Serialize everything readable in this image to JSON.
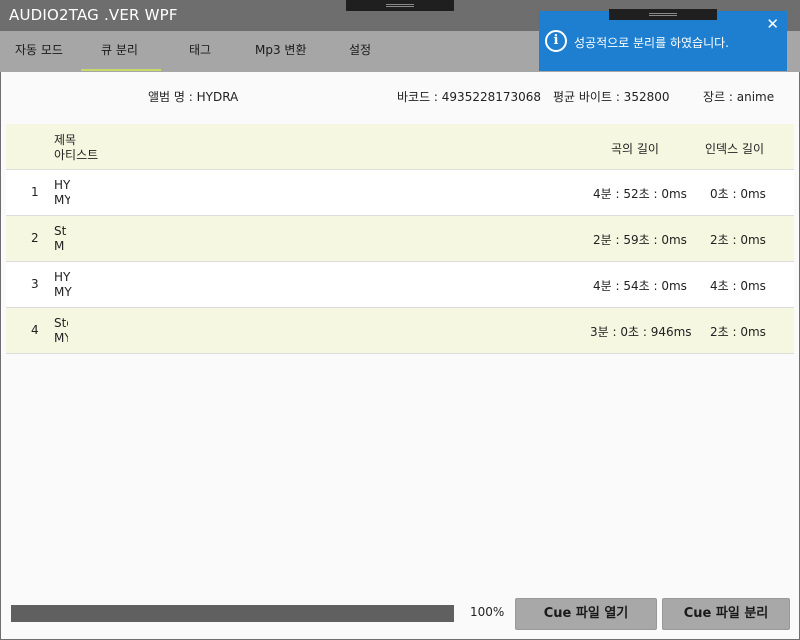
{
  "window": {
    "title": "AUDIO2TAG .VER WPF"
  },
  "tabs": [
    "자동 모드",
    "큐 분리",
    "태그",
    "Mp3 변환",
    "설정"
  ],
  "album": {
    "name_label": "앨범 명 : HYDRA",
    "barcode_label": "바코드 : 4935228173068",
    "bitrate_label": "평균 바이트 : 352800",
    "genre_label": "장르 : anime"
  },
  "table": {
    "headers": {
      "title": "제목",
      "artist": "아티스트",
      "length": "곡의 길이",
      "index_length": "인덱스 길이"
    },
    "rows": [
      {
        "no": "1",
        "title": "HY",
        "artist": "MY",
        "length": "4분 : 52초 : 0ms",
        "index": "0초 : 0ms"
      },
      {
        "no": "2",
        "title": "St",
        "artist": "M",
        "length": "2분 : 59초 : 0ms",
        "index": "2초 : 0ms"
      },
      {
        "no": "3",
        "title": "HY",
        "artist": "MY",
        "length": "4분 : 54초 : 0ms",
        "index": "4초 : 0ms"
      },
      {
        "no": "4",
        "title": "Sto",
        "artist": "MY",
        "length": "3분 : 0초 : 946ms",
        "index": "2초 : 0ms"
      }
    ]
  },
  "progress": {
    "value": 1.0,
    "label": "100%"
  },
  "buttons": {
    "open_cue": "Cue 파일 열기",
    "split_cue": "Cue 파일 분리"
  },
  "toast": {
    "message": "성공적으로 분리를 하였습니다.",
    "icon": "info-icon",
    "close_icon": "close-icon",
    "color": "#1e7fd0"
  },
  "colors": {
    "titlebar": "#6e6e6e",
    "tabbar": "#a6a6a6",
    "row_alt": "#f6f7e0",
    "tab_accent": "#c9d86a"
  }
}
